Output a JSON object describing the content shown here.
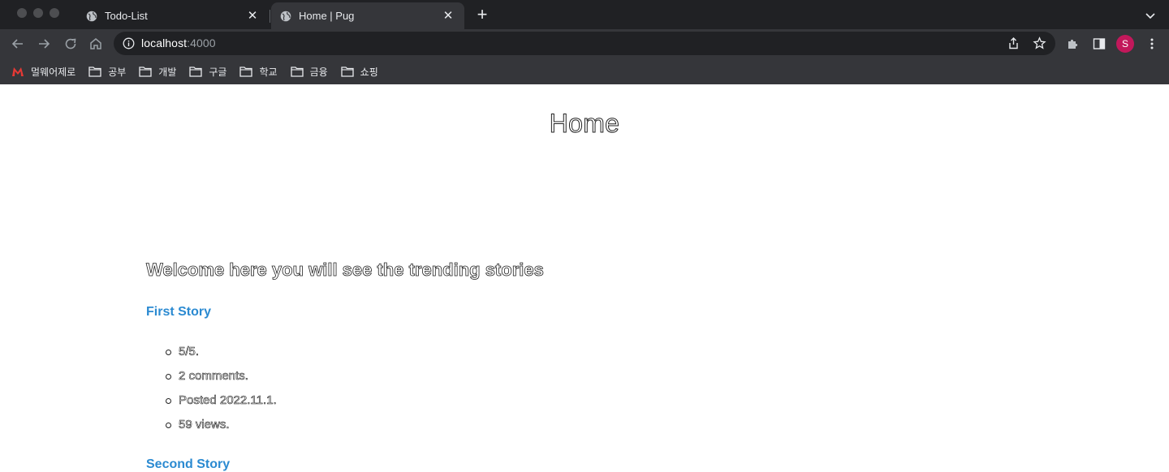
{
  "browser": {
    "tabs": [
      {
        "title": "Todo-List",
        "active": false
      },
      {
        "title": "Home | Pug",
        "active": true
      }
    ],
    "address": {
      "host": "localhost",
      "port": ":4000"
    },
    "profile_initial": "S",
    "bookmarks": [
      {
        "label": "멀웨어제로",
        "icon": "malwarezero-logo-icon"
      },
      {
        "label": "공부",
        "icon": "folder-icon"
      },
      {
        "label": "개발",
        "icon": "folder-icon"
      },
      {
        "label": "구글",
        "icon": "folder-icon"
      },
      {
        "label": "학교",
        "icon": "folder-icon"
      },
      {
        "label": "금융",
        "icon": "folder-icon"
      },
      {
        "label": "쇼핑",
        "icon": "folder-icon"
      }
    ]
  },
  "page": {
    "title": "Home",
    "welcome": "Welcome here you will see the trending stories",
    "stories": [
      {
        "title": "First Story",
        "meta": [
          "5/5.",
          "2 comments.",
          "Posted 2022.11.1.",
          "59 views."
        ]
      },
      {
        "title": "Second Story"
      }
    ]
  },
  "colors": {
    "chrome_bg": "#35363a",
    "titlebar_bg": "#202124",
    "link": "#2b8ad1",
    "profile": "#c2185b"
  }
}
